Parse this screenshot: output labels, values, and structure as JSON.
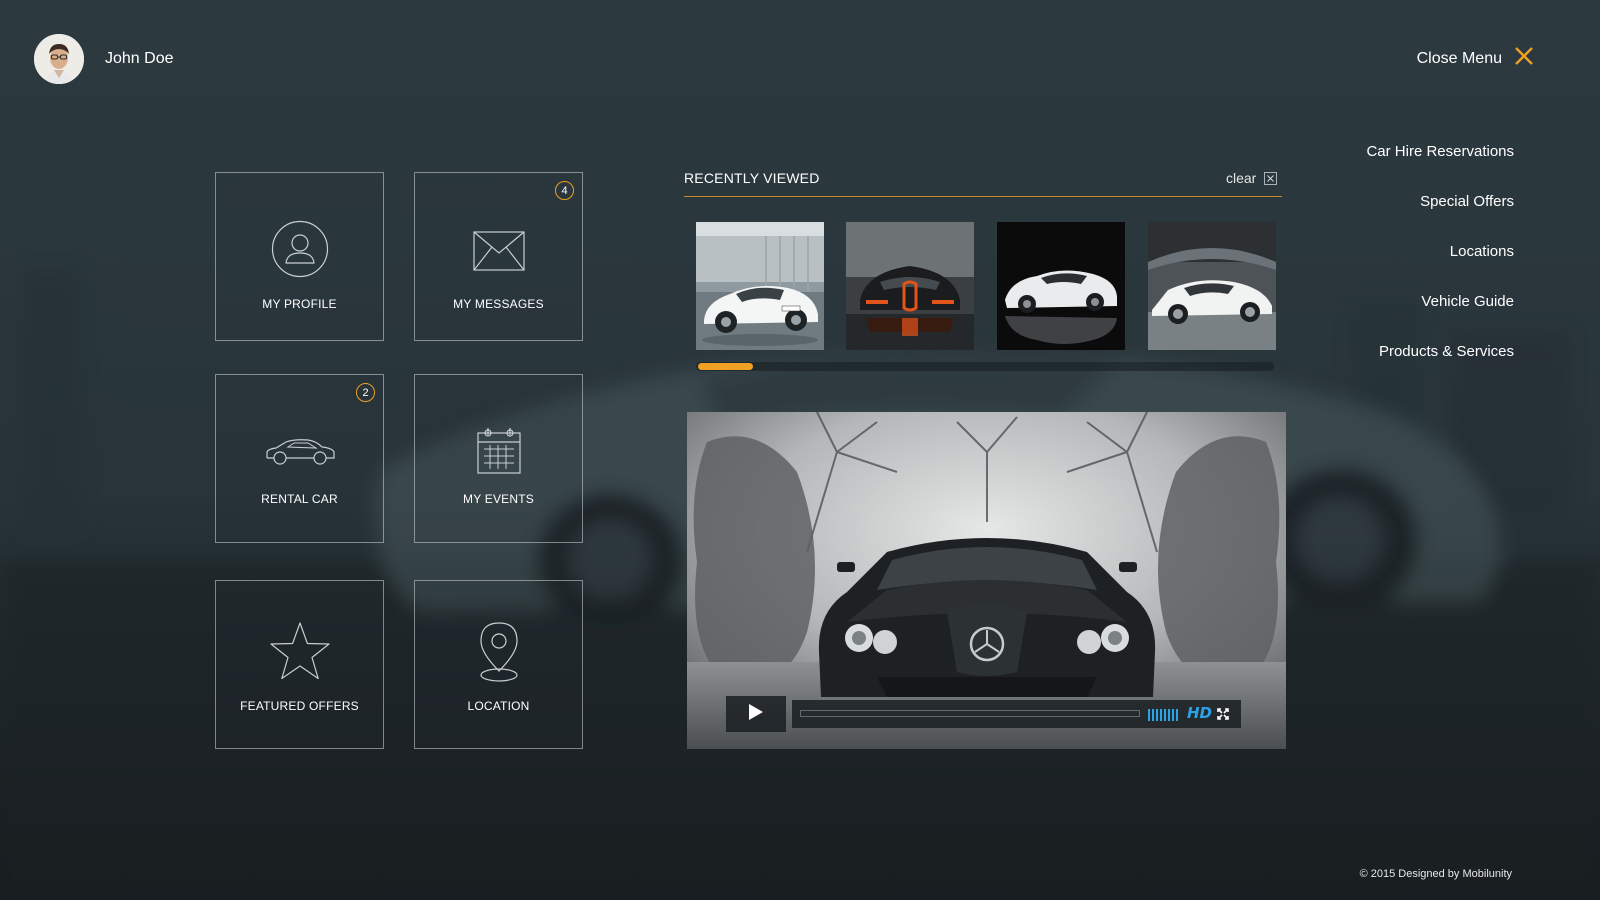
{
  "user": {
    "name": "John Doe"
  },
  "header": {
    "close_menu_label": "Close Menu"
  },
  "tiles": [
    {
      "label": "MY PROFILE",
      "icon": "user-icon"
    },
    {
      "label": "MY MESSAGES",
      "icon": "envelope-icon",
      "badge": "4"
    },
    {
      "label": "RENTAL CAR",
      "icon": "car-icon",
      "badge": "2"
    },
    {
      "label": "MY EVENTS",
      "icon": "calendar-icon"
    },
    {
      "label": "FEATURED OFFERS",
      "icon": "star-icon"
    },
    {
      "label": "LOCATION",
      "icon": "map-pin-icon"
    }
  ],
  "recently_viewed": {
    "title": "RECENTLY VIEWED",
    "clear_label": "clear",
    "scroll_position": 0.1
  },
  "video": {
    "quality_label": "HD"
  },
  "nav": {
    "items": [
      "Car Hire Reservations",
      "Special Offers",
      "Locations",
      "Vehicle Guide",
      "Products & Services"
    ]
  },
  "footer": {
    "text": "© 2015 Designed by  Mobilunity"
  },
  "colors": {
    "accent": "#f0a023",
    "hd": "#2aa3e8",
    "background": "#2a363b"
  }
}
